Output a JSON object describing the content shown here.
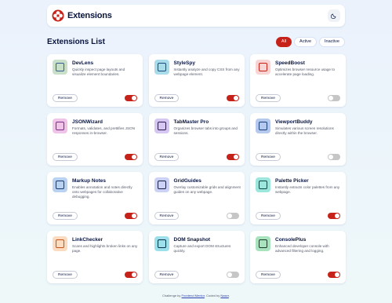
{
  "header": {
    "title": "Extensions",
    "logo_icon": "extensions-logo-icon",
    "theme_icon": "moon-icon",
    "accent": "#c7221a"
  },
  "list": {
    "title": "Extensions List",
    "filters": [
      {
        "label": "All",
        "active": true
      },
      {
        "label": "Active",
        "active": false
      },
      {
        "label": "Inactive",
        "active": false
      }
    ]
  },
  "extensions": [
    {
      "name": "DevLens",
      "description": "Quickly inspect page layouts and visualize element boundaries.",
      "icon": "devlens-icon",
      "icon_bg": "#c8dfc8",
      "icon_fg": "#3c5a9a",
      "enabled": true
    },
    {
      "name": "StyleSpy",
      "description": "Instantly analyze and copy CSS from any webpage element.",
      "icon": "stylespy-icon",
      "icon_bg": "#a9dcea",
      "icon_fg": "#1f4a7a",
      "enabled": true
    },
    {
      "name": "SpeedBoost",
      "description": "Optimizes browser resource usage to accelerate page loading.",
      "icon": "speedboost-icon",
      "icon_bg": "#f7d5d5",
      "icon_fg": "#c7221a",
      "enabled": false
    },
    {
      "name": "JSONWizard",
      "description": "Formats, validates, and prettifies JSON responses in-browser.",
      "icon": "jsonwizard-icon",
      "icon_bg": "#f0c4e8",
      "icon_fg": "#7a2f86",
      "enabled": true
    },
    {
      "name": "TabMaster Pro",
      "description": "Organizes browser tabs into groups and sessions.",
      "icon": "tabmaster-icon",
      "icon_bg": "#d5c7f2",
      "icon_fg": "#2b1d52",
      "enabled": true
    },
    {
      "name": "ViewportBuddy",
      "description": "Simulates various screen resolutions directly within the browser.",
      "icon": "viewportbuddy-icon",
      "icon_bg": "#b5c9ee",
      "icon_fg": "#1d3f7a",
      "enabled": false
    },
    {
      "name": "Markup Notes",
      "description": "Enables annotation and notes directly onto webpages for collaborative debugging.",
      "icon": "markup-notes-icon",
      "icon_bg": "#b9d2f2",
      "icon_fg": "#1d3a6e",
      "enabled": true
    },
    {
      "name": "GridGuides",
      "description": "Overlay customizable grids and alignment guides on any webpage.",
      "icon": "gridguides-icon",
      "icon_bg": "#ccd2f5",
      "icon_fg": "#1c2147",
      "enabled": false
    },
    {
      "name": "Palette Picker",
      "description": "Instantly extracts color palettes from any webpage.",
      "icon": "palette-picker-icon",
      "icon_bg": "#9de6de",
      "icon_fg": "#0f4a45",
      "enabled": true
    },
    {
      "name": "LinkChecker",
      "description": "Scans and highlights broken links on any page.",
      "icon": "linkchecker-icon",
      "icon_bg": "#fbdcc0",
      "icon_fg": "#c7521a",
      "enabled": true
    },
    {
      "name": "DOM Snapshot",
      "description": "Capture and export DOM structures quickly.",
      "icon": "dom-snapshot-icon",
      "icon_bg": "#9be0ea",
      "icon_fg": "#0d2f48",
      "enabled": false
    },
    {
      "name": "ConsolePlus",
      "description": "Enhanced developer console with advanced filtering and logging.",
      "icon": "consoleplus-icon",
      "icon_bg": "#a8e3bd",
      "icon_fg": "#1b3a2c",
      "enabled": true
    }
  ],
  "card": {
    "remove_label": "Remove"
  },
  "footer": {
    "prefix": "Challenge by",
    "challenge_link": "Frontend Mentor",
    "middle": ". Coded by",
    "author_link": "Naser",
    "suffix": "."
  }
}
